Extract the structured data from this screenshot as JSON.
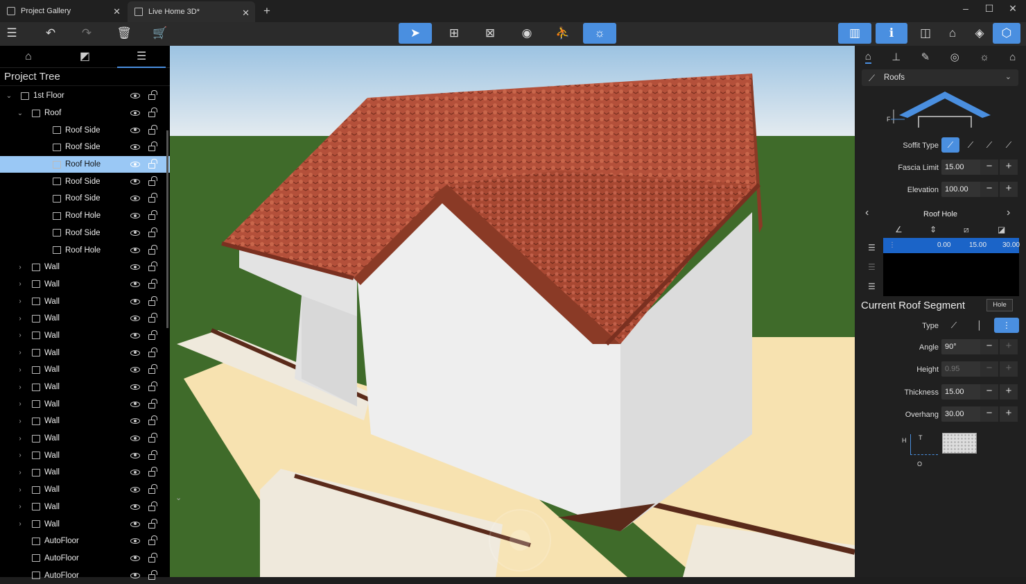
{
  "titlebar": {
    "tabs": [
      {
        "label": "Project Gallery"
      },
      {
        "label": "Live Home 3D*"
      }
    ]
  },
  "project_tree": {
    "title": "Project Tree",
    "rows": [
      {
        "label": "1st Floor",
        "depth": 0,
        "expander": "open",
        "icon": "floor-icon"
      },
      {
        "label": "Roof",
        "depth": 1,
        "expander": "open",
        "icon": "roof-icon"
      },
      {
        "label": "Roof Side",
        "depth": 2,
        "icon": "roof-side-icon"
      },
      {
        "label": "Roof Side",
        "depth": 2,
        "icon": "roof-side-icon"
      },
      {
        "label": "Roof Hole",
        "depth": 2,
        "icon": "roof-hole-icon",
        "selected": true
      },
      {
        "label": "Roof Side",
        "depth": 2,
        "icon": "roof-side-icon"
      },
      {
        "label": "Roof Side",
        "depth": 2,
        "icon": "roof-side-icon"
      },
      {
        "label": "Roof Hole",
        "depth": 2,
        "icon": "roof-hole-icon"
      },
      {
        "label": "Roof Side",
        "depth": 2,
        "icon": "roof-side-icon"
      },
      {
        "label": "Roof Hole",
        "depth": 2,
        "icon": "roof-hole-icon"
      },
      {
        "label": "Wall",
        "depth": 1,
        "expander": "closed",
        "icon": "wall-icon"
      },
      {
        "label": "Wall",
        "depth": 1,
        "expander": "closed",
        "icon": "wall-icon"
      },
      {
        "label": "Wall",
        "depth": 1,
        "expander": "closed",
        "icon": "wall-icon"
      },
      {
        "label": "Wall",
        "depth": 1,
        "expander": "closed",
        "icon": "wall-icon"
      },
      {
        "label": "Wall",
        "depth": 1,
        "expander": "closed",
        "icon": "wall-icon"
      },
      {
        "label": "Wall",
        "depth": 1,
        "expander": "closed",
        "icon": "wall-icon"
      },
      {
        "label": "Wall",
        "depth": 1,
        "expander": "closed",
        "icon": "wall-icon"
      },
      {
        "label": "Wall",
        "depth": 1,
        "expander": "closed",
        "icon": "wall-icon"
      },
      {
        "label": "Wall",
        "depth": 1,
        "expander": "closed",
        "icon": "wall-icon"
      },
      {
        "label": "Wall",
        "depth": 1,
        "expander": "closed",
        "icon": "wall-icon"
      },
      {
        "label": "Wall",
        "depth": 1,
        "expander": "closed",
        "icon": "wall-icon"
      },
      {
        "label": "Wall",
        "depth": 1,
        "expander": "closed",
        "icon": "wall-icon"
      },
      {
        "label": "Wall",
        "depth": 1,
        "expander": "closed",
        "icon": "wall-icon"
      },
      {
        "label": "Wall",
        "depth": 1,
        "expander": "closed",
        "icon": "wall-icon"
      },
      {
        "label": "Wall",
        "depth": 1,
        "expander": "closed",
        "icon": "wall-icon"
      },
      {
        "label": "Wall",
        "depth": 1,
        "expander": "closed",
        "icon": "wall-icon"
      },
      {
        "label": "AutoFloor",
        "depth": 1,
        "icon": "floor-icon"
      },
      {
        "label": "AutoFloor",
        "depth": 1,
        "icon": "floor-icon"
      },
      {
        "label": "AutoFloor",
        "depth": 1,
        "icon": "floor-icon"
      }
    ]
  },
  "inspector": {
    "dropdown": "Roofs",
    "diagram_label": "F",
    "soffit_type_label": "Soffit Type",
    "fascia_limit": {
      "label": "Fascia Limit",
      "value": "15.00"
    },
    "elevation": {
      "label": "Elevation",
      "value": "100.00"
    },
    "segment_nav_title": "Roof Hole",
    "segment_values": [
      "0.00",
      "15.00",
      "30.00"
    ],
    "section_title": "Current Roof Segment",
    "tooltip": "Hole",
    "type_label": "Type",
    "angle": {
      "label": "Angle",
      "value": "90°"
    },
    "height": {
      "label": "Height",
      "value": "0.95"
    },
    "thickness": {
      "label": "Thickness",
      "value": "15.00"
    },
    "overhang": {
      "label": "Overhang",
      "value": "30.00"
    },
    "preview_labels": {
      "h": "H",
      "t": "T",
      "o": "O"
    }
  },
  "colors": {
    "accent": "#4a8fe0",
    "selection": "#9ac8f5",
    "roof_tile": "#b4503a",
    "grass": "#3f6b2a",
    "sky_top": "#9cc3e2"
  }
}
